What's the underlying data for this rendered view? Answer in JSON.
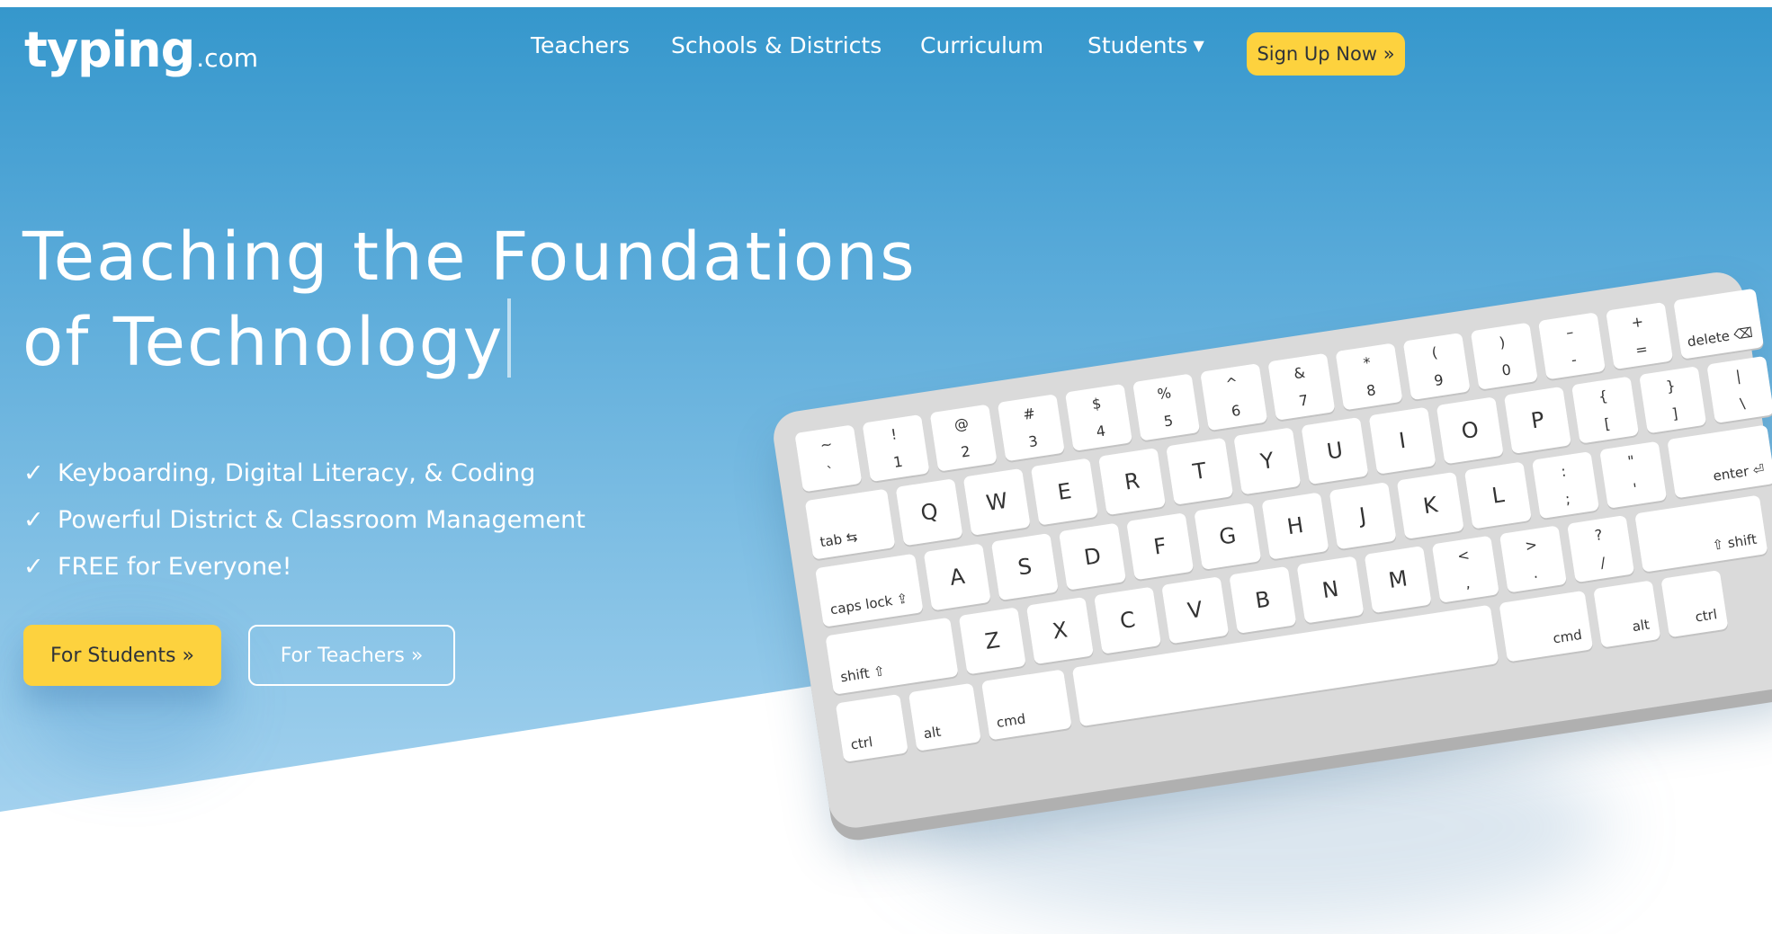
{
  "nav": {
    "logo_word": "typing",
    "logo_tld": ".com",
    "links": [
      {
        "label": "Teachers"
      },
      {
        "label": "Schools & Districts"
      },
      {
        "label": "Curriculum"
      },
      {
        "label": "Students",
        "icon": "caret-down-icon"
      }
    ],
    "signup": "Sign Up Now »"
  },
  "hero": {
    "headline_line1": "Teaching the Foundations",
    "headline_line2": "of Technology",
    "features": [
      "Keyboarding, Digital Literacy, & Coding",
      "Powerful District & Classroom Management",
      "FREE for Everyone!"
    ],
    "btn_students": "For Students »",
    "btn_teachers": "For Teachers »"
  },
  "keyboard": {
    "rows": [
      [
        [
          "~",
          "`"
        ],
        [
          "!",
          "1"
        ],
        [
          "@",
          "2"
        ],
        [
          "#",
          "3"
        ],
        [
          "$",
          "4"
        ],
        [
          "%",
          "5"
        ],
        [
          "^",
          "6"
        ],
        [
          "&",
          "7"
        ],
        [
          "*",
          "8"
        ],
        [
          "(",
          "9"
        ],
        [
          ")",
          "0"
        ],
        [
          "–",
          "-"
        ],
        [
          "+",
          "="
        ],
        [
          "delete ⌫"
        ]
      ],
      [
        [
          "tab ⇆"
        ],
        "Q",
        "W",
        "E",
        "R",
        "T",
        "Y",
        "U",
        "I",
        "O",
        "P",
        [
          "{",
          "["
        ],
        [
          "}",
          "]"
        ],
        [
          "|",
          "\\"
        ]
      ],
      [
        [
          "caps lock ⇪"
        ],
        "A",
        "S",
        "D",
        "F",
        "G",
        "H",
        "J",
        "K",
        "L",
        [
          ":",
          ";"
        ],
        [
          "\"",
          "'"
        ],
        [
          "enter ⏎"
        ]
      ],
      [
        [
          "shift ⇧"
        ],
        "Z",
        "X",
        "C",
        "V",
        "B",
        "N",
        "M",
        [
          "<",
          ","
        ],
        [
          ">",
          "."
        ],
        [
          "?",
          "/"
        ],
        [
          "⇧ shift"
        ]
      ],
      [
        [
          "ctrl"
        ],
        [
          "alt"
        ],
        [
          "cmd"
        ],
        [
          ""
        ],
        [
          "cmd"
        ],
        [
          "alt"
        ],
        [
          "ctrl"
        ]
      ]
    ]
  },
  "colors": {
    "hero_top": "#3597cc",
    "hero_bottom": "#a6d3ef",
    "accent_yellow": "#fdd23e",
    "key_face": "#ffffff",
    "keyboard_body": "#dadada"
  }
}
